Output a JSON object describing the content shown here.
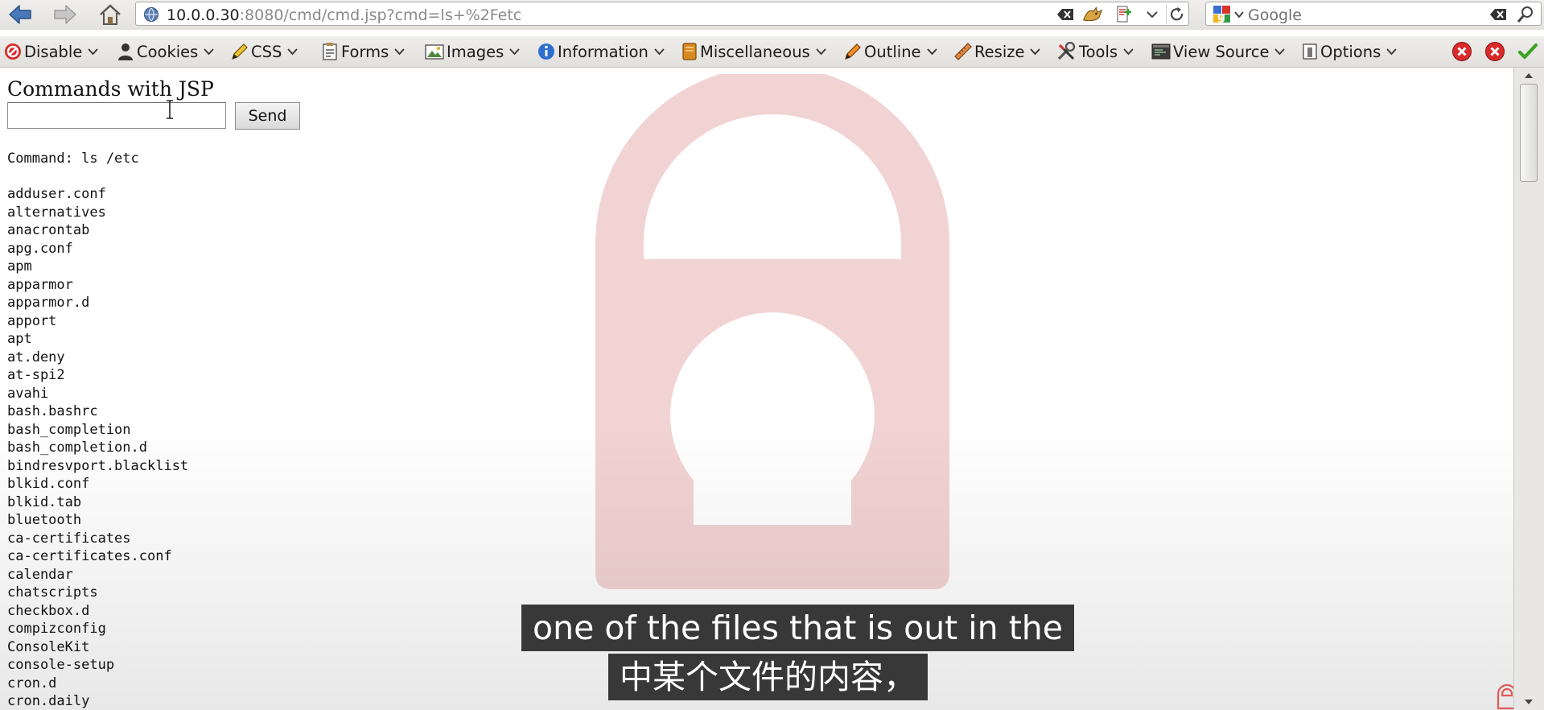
{
  "browser": {
    "url_host": "10.0.0.30",
    "url_rest": ":8080/cmd/cmd.jsp?cmd=ls+%2Fetc",
    "search_placeholder": "Google",
    "icons": [
      "back-arrow-icon",
      "forward-arrow-icon",
      "home-icon",
      "site-globe-icon",
      "clear-url-icon",
      "tomcat-addon-icon",
      "bookmark-icon",
      "dropdown-icon",
      "reload-icon",
      "google-search-engine-icon",
      "clear-search-icon",
      "magnifier-icon"
    ]
  },
  "devtoolbar": {
    "items": [
      {
        "label": "Disable",
        "icon": "disable-icon"
      },
      {
        "label": "Cookies",
        "icon": "cookies-icon"
      },
      {
        "label": "CSS",
        "icon": "css-pencil-icon"
      },
      {
        "label": "Forms",
        "icon": "forms-icon"
      },
      {
        "label": "Images",
        "icon": "images-icon"
      },
      {
        "label": "Information",
        "icon": "info-icon"
      },
      {
        "label": "Miscellaneous",
        "icon": "miscellaneous-icon"
      },
      {
        "label": "Outline",
        "icon": "outline-pencil-icon"
      },
      {
        "label": "Resize",
        "icon": "resize-ruler-icon"
      },
      {
        "label": "Tools",
        "icon": "tools-icon"
      },
      {
        "label": "View Source",
        "icon": "view-source-icon"
      },
      {
        "label": "Options",
        "icon": "options-icon"
      }
    ],
    "status_icons": [
      "error-red-icon",
      "error-red-icon",
      "valid-check-icon"
    ],
    "colors": {
      "error": "#d92b2b",
      "valid": "#3aa320"
    }
  },
  "page": {
    "title": "Commands with JSP",
    "input_value": "",
    "send_label": "Send",
    "command_line": "Command: ls /etc",
    "files": [
      "adduser.conf",
      "alternatives",
      "anacrontab",
      "apg.conf",
      "apm",
      "apparmor",
      "apparmor.d",
      "apport",
      "apt",
      "at.deny",
      "at-spi2",
      "avahi",
      "bash.bashrc",
      "bash_completion",
      "bash_completion.d",
      "bindresvport.blacklist",
      "blkid.conf",
      "blkid.tab",
      "bluetooth",
      "ca-certificates",
      "ca-certificates.conf",
      "calendar",
      "chatscripts",
      "checkbox.d",
      "compizconfig",
      "ConsoleKit",
      "console-setup",
      "cron.d",
      "cron.daily"
    ]
  },
  "subtitles": {
    "line1": "one of the files that is out in the",
    "line2": "中某个文件的内容，"
  },
  "watermark": {
    "icon": "lock-lightbulb-watermark-icon",
    "color": "#f2d3d3"
  }
}
